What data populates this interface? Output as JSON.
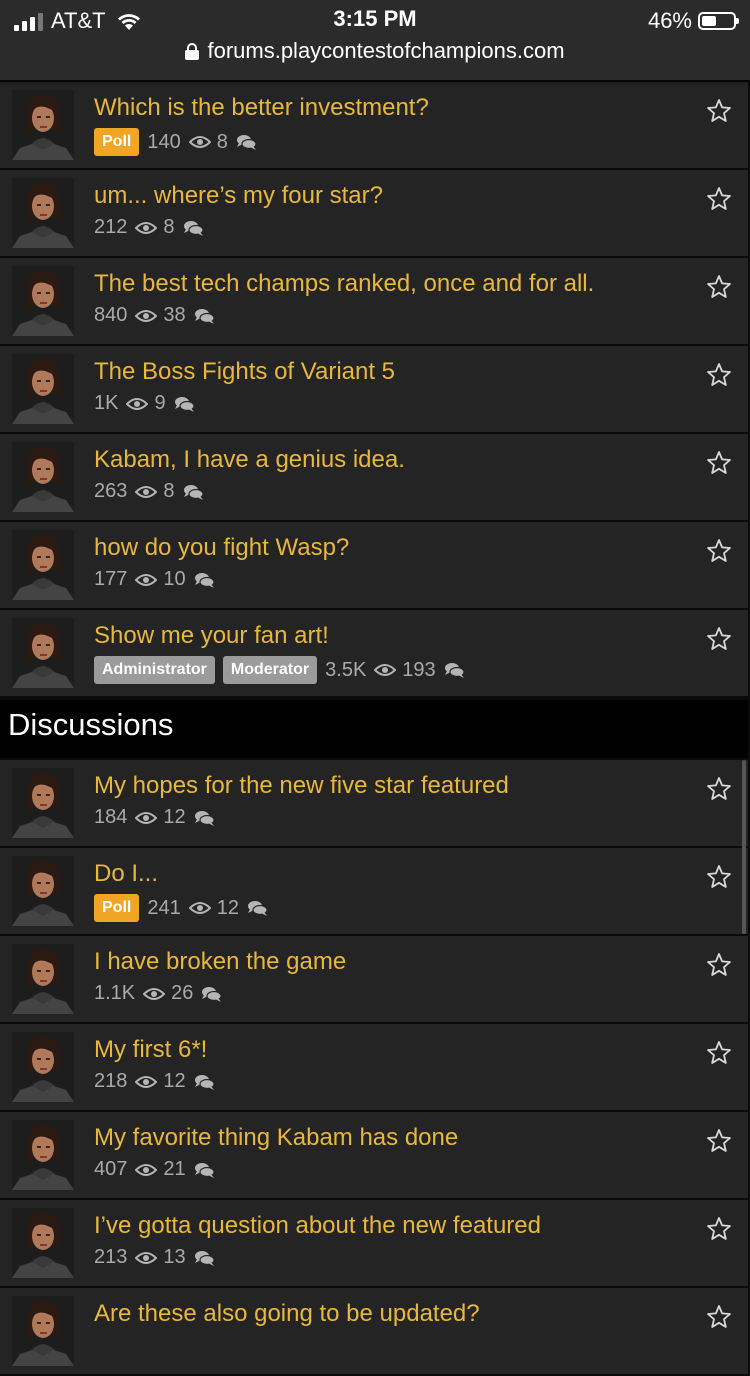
{
  "status": {
    "carrier": "AT&T",
    "time": "3:15 PM",
    "battery": "46%",
    "battery_level": 0.46,
    "url": "forums.playcontestofchampions.com"
  },
  "announcements": [
    {
      "title": "Which is the better investment?",
      "tags": [
        "Poll"
      ],
      "views": "140",
      "comments": "8"
    },
    {
      "title": "um... where’s my four star?",
      "tags": [],
      "views": "212",
      "comments": "8"
    },
    {
      "title": "The best tech champs ranked, once and for all.",
      "tags": [],
      "views": "840",
      "comments": "38"
    },
    {
      "title": "The Boss Fights of Variant 5",
      "tags": [],
      "views": "1K",
      "comments": "9"
    },
    {
      "title": "Kabam, I have a genius idea.",
      "tags": [],
      "views": "263",
      "comments": "8"
    },
    {
      "title": "how do you fight Wasp?",
      "tags": [],
      "views": "177",
      "comments": "10"
    },
    {
      "title": "Show me your fan art!",
      "tags": [
        "Administrator",
        "Moderator"
      ],
      "views": "3.5K",
      "comments": "193"
    }
  ],
  "discussions_header": "Discussions",
  "discussions": [
    {
      "title": "My hopes for the new five star featured",
      "tags": [],
      "views": "184",
      "comments": "12"
    },
    {
      "title": "Do I...",
      "tags": [
        "Poll"
      ],
      "views": "241",
      "comments": "12"
    },
    {
      "title": "I have broken the game",
      "tags": [],
      "views": "1.1K",
      "comments": "26"
    },
    {
      "title": "My first 6*!",
      "tags": [],
      "views": "218",
      "comments": "12"
    },
    {
      "title": "My favorite thing Kabam has done",
      "tags": [],
      "views": "407",
      "comments": "21"
    },
    {
      "title": "I’ve gotta question about the new featured",
      "tags": [],
      "views": "213",
      "comments": "13"
    },
    {
      "title": "Are these also going to be updated?",
      "tags": [],
      "views": "",
      "comments": ""
    }
  ],
  "icons": {
    "views": "eye-icon",
    "comments": "comment-bubbles-icon",
    "bookmark": "star-icon",
    "avatar": "user-avatar"
  },
  "colors": {
    "title": "#e9b83a",
    "poll": "#f0a624",
    "role": "#9b9b9b",
    "row_bg": "#242424"
  }
}
